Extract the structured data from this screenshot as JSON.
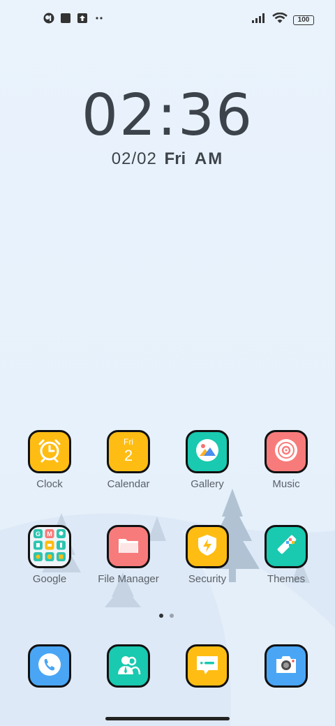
{
  "status_bar": {
    "battery_level": "100",
    "icons": [
      "app-notification-icon",
      "square-notification-icon",
      "upload-notification-icon",
      "more-notifications-icon",
      "signal-icon",
      "wifi-icon",
      "battery-icon"
    ]
  },
  "lock_clock": {
    "time": "02:36",
    "date": "02/02",
    "weekday": "Fri",
    "ampm": "AM"
  },
  "apps": [
    {
      "label": "Clock",
      "icon": "alarm-clock-icon",
      "color": "#ffbd13"
    },
    {
      "label": "Calendar",
      "icon": "calendar-icon",
      "color": "#ffbd13",
      "day_name": "Fri",
      "day_number": "2"
    },
    {
      "label": "Gallery",
      "icon": "gallery-icon",
      "color": "#19c9b0"
    },
    {
      "label": "Music",
      "icon": "music-disc-icon",
      "color": "#f87b7b"
    },
    {
      "label": "Google",
      "icon": "folder-icon",
      "color": "#eef4f8"
    },
    {
      "label": "File Manager",
      "icon": "folder-icon",
      "color": "#f87b7b"
    },
    {
      "label": "Security",
      "icon": "shield-icon",
      "color": "#ffbd13"
    },
    {
      "label": "Themes",
      "icon": "brush-icon",
      "color": "#19c9b0"
    }
  ],
  "dock": [
    {
      "name": "phone",
      "icon": "phone-icon",
      "color": "#4aa6f5"
    },
    {
      "name": "contacts",
      "icon": "contacts-icon",
      "color": "#19c9b0"
    },
    {
      "name": "messages",
      "icon": "message-icon",
      "color": "#ffbd13"
    },
    {
      "name": "camera",
      "icon": "camera-icon",
      "color": "#4aa6f5"
    }
  ],
  "pager": {
    "pages": 2,
    "current": 1
  }
}
